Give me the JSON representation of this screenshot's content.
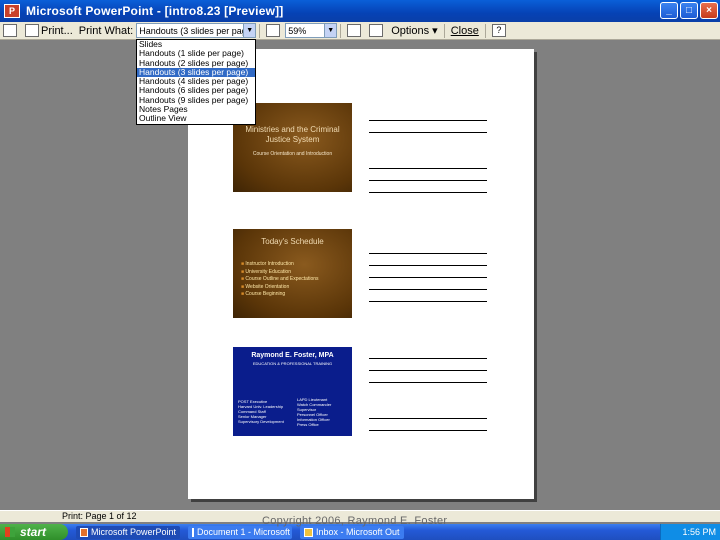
{
  "window": {
    "title": "Microsoft PowerPoint - [intro8.23 [Preview]]",
    "app_icon": "powerpoint-icon"
  },
  "toolbar": {
    "print_label": "Print...",
    "print_what_label": "Print What:",
    "print_what_value": "Handouts (3 slides per page)",
    "zoom_value": "59%",
    "options_label": "Options",
    "close_label": "Close",
    "help_label": "?"
  },
  "dropdown": {
    "items": [
      "Slides",
      "Handouts (1 slide per page)",
      "Handouts (2 slides per page)",
      "Handouts (3 slides per page)",
      "Handouts (4 slides per page)",
      "Handouts (6 slides per page)",
      "Handouts (9 slides per page)",
      "Notes Pages",
      "Outline View"
    ],
    "selected_index": 3
  },
  "slides": [
    {
      "title": "Ministries and the Criminal Justice System",
      "subtitle": "Course Orientation and Introduction"
    },
    {
      "title": "Today's Schedule",
      "bullets": [
        "Instructor Introduction",
        "University Education",
        "Course Outline and Expectations",
        "Website Orientation",
        "Course Beginning"
      ]
    },
    {
      "title": "Raymond E. Foster, MPA",
      "subtitle": "EDUCATION & PROFESSIONAL TRAINING",
      "col_left": [
        "POST Executive",
        "Harvard Univ. Leadership",
        "Command Staff",
        "Senior Manager",
        "Supervisory Development"
      ],
      "col_right": [
        "LAPD Lieutenant",
        "Watch Commander",
        "Supervisor",
        "Personnel Officer",
        "Information Officer",
        "Press Office"
      ]
    }
  ],
  "status": {
    "page": "Print: Page 1 of 12"
  },
  "footer": {
    "copyright": "Copyright 2006, Raymond E. Foster"
  },
  "taskbar": {
    "start_label": "start",
    "tasks": [
      "Microsoft PowerPoint",
      "Document 1 - Microsoft",
      "Inbox - Microsoft Out"
    ],
    "clock": "1:56 PM"
  }
}
